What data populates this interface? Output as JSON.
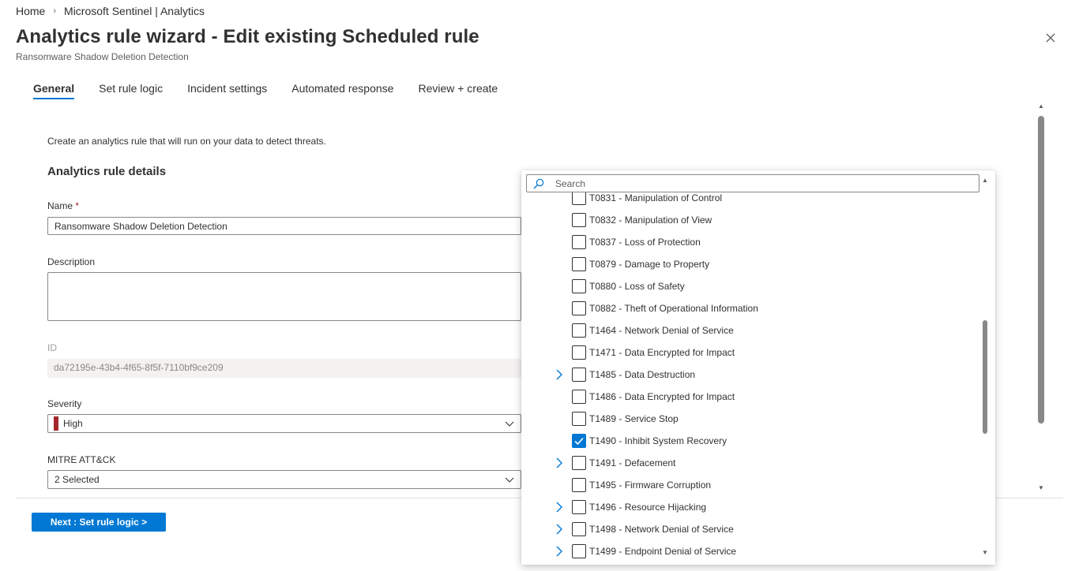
{
  "breadcrumb": {
    "home": "Home",
    "current": "Microsoft Sentinel | Analytics"
  },
  "header": {
    "title": "Analytics rule wizard - Edit existing Scheduled rule",
    "more": "...",
    "subtitle": "Ransomware Shadow Deletion Detection"
  },
  "tabs": [
    {
      "label": "General",
      "active": true
    },
    {
      "label": "Set rule logic",
      "active": false
    },
    {
      "label": "Incident settings",
      "active": false
    },
    {
      "label": "Automated response",
      "active": false
    },
    {
      "label": "Review + create",
      "active": false
    }
  ],
  "form": {
    "intro": "Create an analytics rule that will run on your data to detect threats.",
    "section_title": "Analytics rule details",
    "name_label": "Name",
    "required_mark": "*",
    "name_value": "Ransomware Shadow Deletion Detection",
    "description_label": "Description",
    "description_value": "",
    "id_label": "ID",
    "id_value": "da72195e-43b4-4f65-8f5f-7110bf9ce209",
    "severity_label": "Severity",
    "severity_value": "High",
    "severity_color": "#a4262c",
    "mitre_label": "MITRE ATT&CK",
    "mitre_value": "2 Selected"
  },
  "footer": {
    "next_button": "Next : Set rule logic >"
  },
  "mitre_dropdown": {
    "search_placeholder": "Search",
    "items": [
      {
        "label": "T0831 - Manipulation of Control",
        "checked": false,
        "expandable": false
      },
      {
        "label": "T0832 - Manipulation of View",
        "checked": false,
        "expandable": false
      },
      {
        "label": "T0837 - Loss of Protection",
        "checked": false,
        "expandable": false
      },
      {
        "label": "T0879 - Damage to Property",
        "checked": false,
        "expandable": false
      },
      {
        "label": "T0880 - Loss of Safety",
        "checked": false,
        "expandable": false
      },
      {
        "label": "T0882 - Theft of Operational Information",
        "checked": false,
        "expandable": false
      },
      {
        "label": "T1464 - Network Denial of Service",
        "checked": false,
        "expandable": false
      },
      {
        "label": "T1471 - Data Encrypted for Impact",
        "checked": false,
        "expandable": false
      },
      {
        "label": "T1485 - Data Destruction",
        "checked": false,
        "expandable": true
      },
      {
        "label": "T1486 - Data Encrypted for Impact",
        "checked": false,
        "expandable": false
      },
      {
        "label": "T1489 - Service Stop",
        "checked": false,
        "expandable": false
      },
      {
        "label": "T1490 - Inhibit System Recovery",
        "checked": true,
        "expandable": false
      },
      {
        "label": "T1491 - Defacement",
        "checked": false,
        "expandable": true
      },
      {
        "label": "T1495 - Firmware Corruption",
        "checked": false,
        "expandable": false
      },
      {
        "label": "T1496 - Resource Hijacking",
        "checked": false,
        "expandable": true
      },
      {
        "label": "T1498 - Network Denial of Service",
        "checked": false,
        "expandable": true
      },
      {
        "label": "T1499 - Endpoint Denial of Service",
        "checked": false,
        "expandable": true
      }
    ]
  },
  "colors": {
    "accent": "#0078d4",
    "checkbox_checked": "#0078d4"
  }
}
